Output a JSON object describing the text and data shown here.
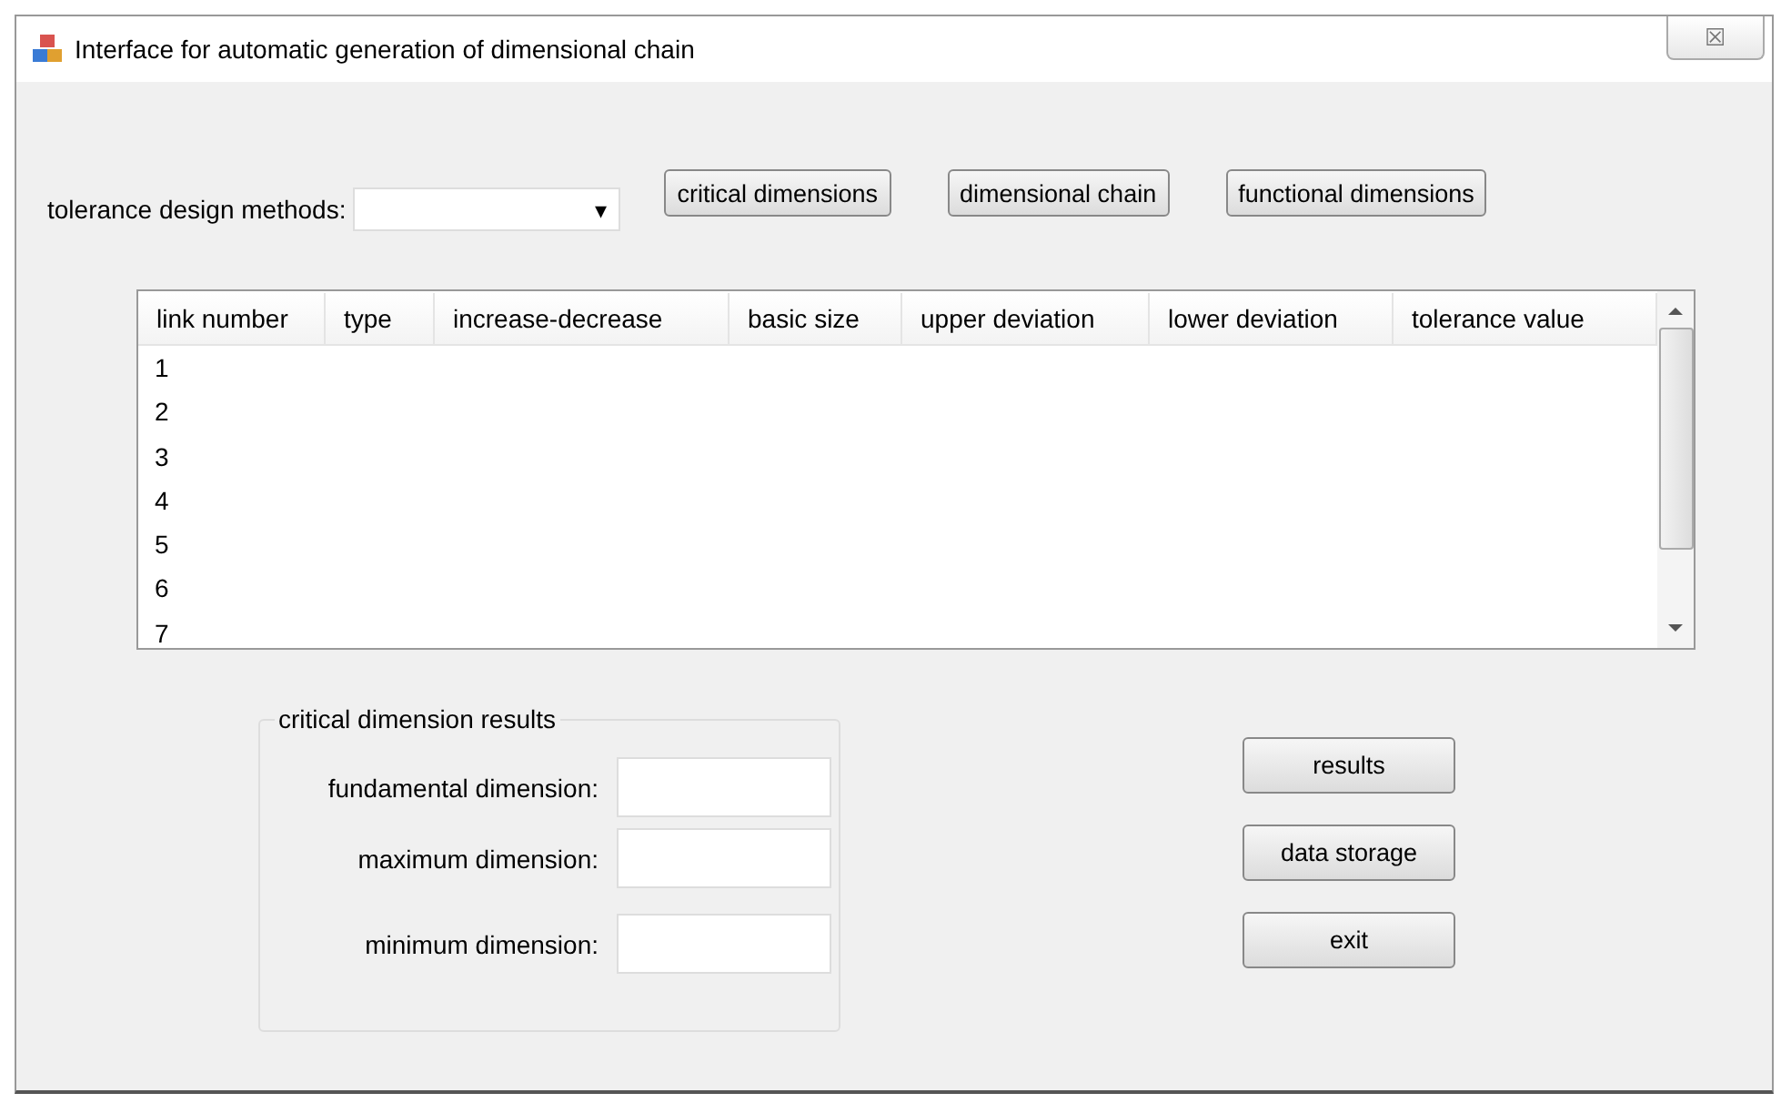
{
  "window": {
    "title": "Interface for automatic generation of dimensional chain",
    "close_label": "☒"
  },
  "method": {
    "label": "tolerance design methods:",
    "combo_arrow": "▾"
  },
  "top_buttons": [
    "critical dimensions",
    "dimensional chain",
    "functional dimensions"
  ],
  "table": {
    "columns": [
      "link number",
      "type",
      "increase-decrease",
      "basic size",
      "upper deviation",
      "lower deviation",
      "tolerance value"
    ],
    "rows": [
      "1",
      "2",
      "3",
      "4",
      "5",
      "6",
      "7"
    ]
  },
  "results_group": {
    "title": "critical dimension results",
    "fields": [
      {
        "label": "fundamental dimension:"
      },
      {
        "label": "maximum dimension:"
      },
      {
        "label": "minimum dimension:"
      }
    ]
  },
  "side_buttons": [
    "results",
    "data storage",
    "exit"
  ]
}
